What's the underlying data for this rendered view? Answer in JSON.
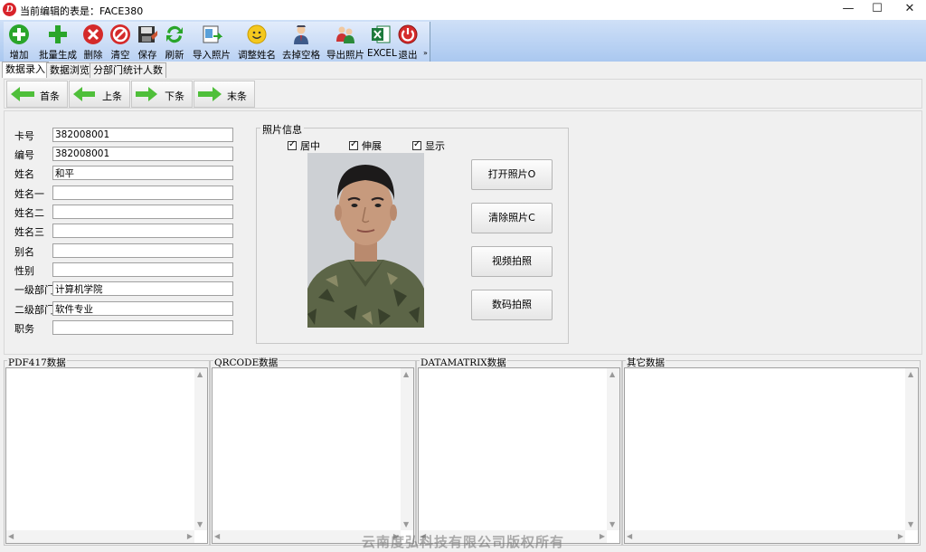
{
  "window": {
    "title": "当前编辑的表是：FACE380",
    "logo": "D",
    "minimize": "—",
    "maximize": "☐",
    "close": "✕"
  },
  "toolbar": {
    "items": [
      {
        "label": "增加",
        "icon": "add-icon"
      },
      {
        "label": "批量生成",
        "icon": "batch-add-icon"
      },
      {
        "label": "删除",
        "icon": "delete-icon"
      },
      {
        "label": "清空",
        "icon": "clear-icon"
      },
      {
        "label": "保存",
        "icon": "save-icon"
      },
      {
        "label": "刷新",
        "icon": "refresh-icon"
      },
      {
        "label": "导入照片",
        "icon": "import-photo-icon"
      },
      {
        "label": "调整姓名",
        "icon": "smiley-icon"
      },
      {
        "label": "去掉空格",
        "icon": "person-icon"
      },
      {
        "label": "导出照片",
        "icon": "export-photo-icon"
      },
      {
        "label": "EXCEL",
        "icon": "excel-icon"
      },
      {
        "label": "退出",
        "icon": "exit-icon"
      }
    ],
    "overflow": "»"
  },
  "tabs": [
    "数据录入",
    "数据浏览",
    "分部门统计人数"
  ],
  "nav": {
    "first": "首条",
    "prev": "上条",
    "next": "下条",
    "last": "末条"
  },
  "form": {
    "fields": [
      {
        "label": "卡号",
        "value": "382008001"
      },
      {
        "label": "编号",
        "value": "382008001"
      },
      {
        "label": "姓名",
        "value": "和平"
      },
      {
        "label": "姓名一",
        "value": ""
      },
      {
        "label": "姓名二",
        "value": ""
      },
      {
        "label": "姓名三",
        "value": ""
      },
      {
        "label": "别名",
        "value": ""
      },
      {
        "label": "性别",
        "value": ""
      },
      {
        "label": "一级部门",
        "value": "计算机学院"
      },
      {
        "label": "二级部门",
        "value": "软件专业"
      },
      {
        "label": "职务",
        "value": ""
      }
    ]
  },
  "photo": {
    "group_title": "照片信息",
    "checkboxes": [
      {
        "label": "居中",
        "checked": true
      },
      {
        "label": "伸展",
        "checked": true
      },
      {
        "label": "显示",
        "checked": true
      }
    ],
    "buttons": [
      "打开照片O",
      "清除照片C",
      "视频拍照",
      "数码拍照"
    ]
  },
  "data_panels": [
    "PDF417数据",
    "QRCODE数据",
    "DATAMATRIX数据",
    "其它数据"
  ],
  "footer": "云南度弘科技有限公司版权所有"
}
